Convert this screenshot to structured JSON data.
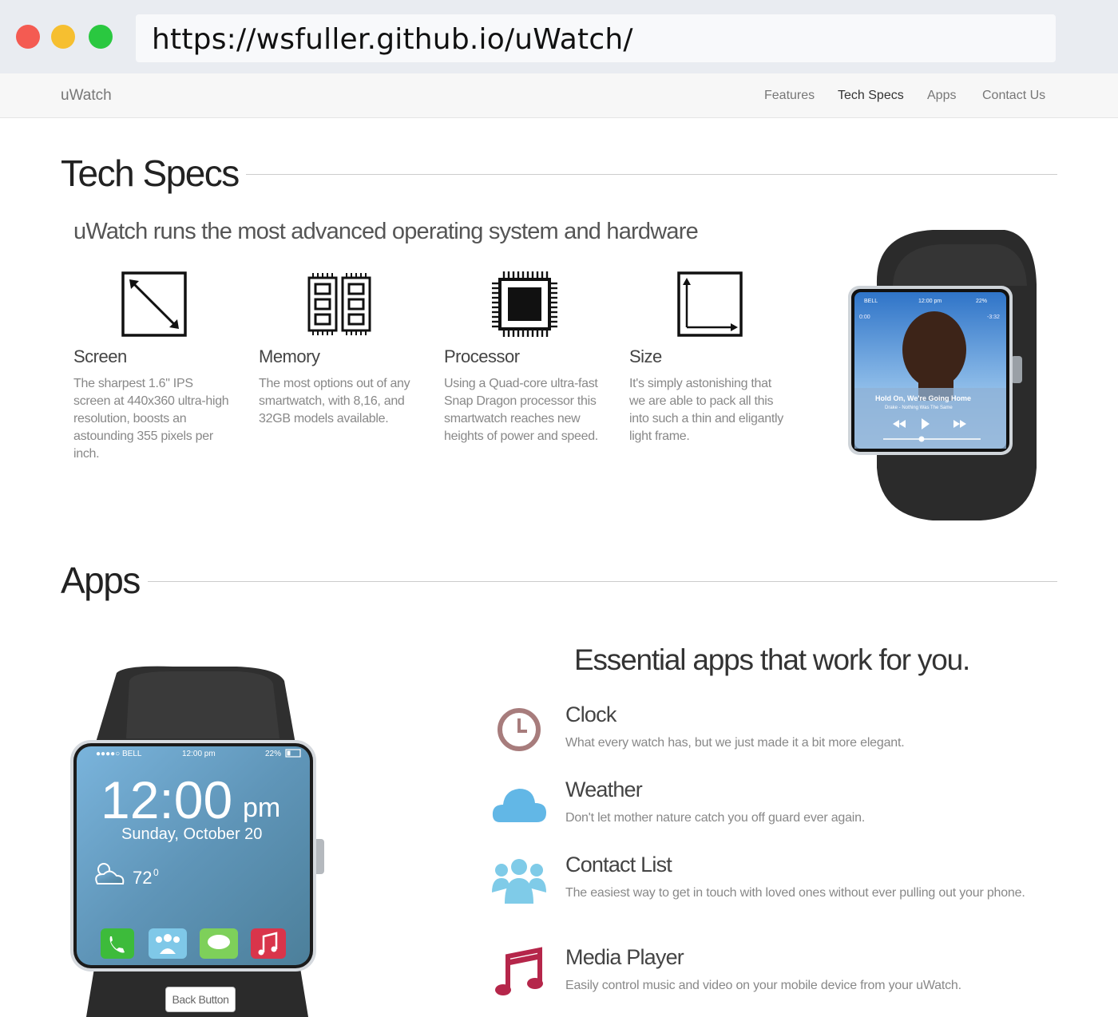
{
  "browser": {
    "url": "https://wsfuller.github.io/uWatch/"
  },
  "navbar": {
    "brand": "uWatch",
    "items": [
      {
        "label": "Features"
      },
      {
        "label": "Tech Specs"
      },
      {
        "label": "Apps"
      },
      {
        "label": "Contact Us"
      }
    ],
    "active": "Tech Specs"
  },
  "tech_specs": {
    "title": "Tech Specs",
    "subtitle": "uWatch runs the most advanced operating system and hardware",
    "specs": [
      {
        "name": "Screen",
        "icon": "diagonal-arrow-icon",
        "desc": "The sharpest 1.6\" IPS screen at 440x360 ultra-high resolution, boosts an astounding 355 pixels per inch."
      },
      {
        "name": "Memory",
        "icon": "memory-chip-icon",
        "desc": "The most options out of any smartwatch, with 8,16, and 32GB models available."
      },
      {
        "name": "Processor",
        "icon": "processor-chip-icon",
        "desc": "Using a Quad-core ultra-fast Snap Dragon processor this smartwatch reaches new heights of power and speed."
      },
      {
        "name": "Size",
        "icon": "dimensions-icon",
        "desc": "It's simply astonishing that we are able to pack all this into such a thin and eligantly light frame."
      }
    ],
    "watch_screen": {
      "carrier": "BELL",
      "time": "12:00 pm",
      "battery": "22%",
      "elapsed": "0:00",
      "remaining": "-3:32",
      "song": "Hold On, We're Going Home",
      "artist_album": "Drake - Nothing Was The Same"
    }
  },
  "apps": {
    "title": "Apps",
    "tagline": "Essential apps that work for you.",
    "list": [
      {
        "name": "Clock",
        "icon": "clock-icon",
        "color": "#a77c7c",
        "desc": "What every watch has, but we just made it a bit more elegant."
      },
      {
        "name": "Weather",
        "icon": "cloud-icon",
        "color": "#62b7e6",
        "desc": "Don't let mother nature catch you off guard ever again."
      },
      {
        "name": "Contact List",
        "icon": "contacts-icon",
        "color": "#7fcbe8",
        "desc": "The easiest way to get in touch with loved ones without ever pulling out your phone."
      },
      {
        "name": "Media Player",
        "icon": "music-note-icon",
        "color": "#b5264a",
        "desc": "Easily control music and video on your mobile device from your uWatch."
      }
    ],
    "watch_screen": {
      "carrier": "●●●●○ BELL",
      "status_time": "12:00 pm",
      "battery": "22%",
      "time": "12:00",
      "ampm": "pm",
      "date": "Sunday,  October 20",
      "temperature": "72",
      "degree": "0",
      "back_button": "Back Button"
    }
  }
}
